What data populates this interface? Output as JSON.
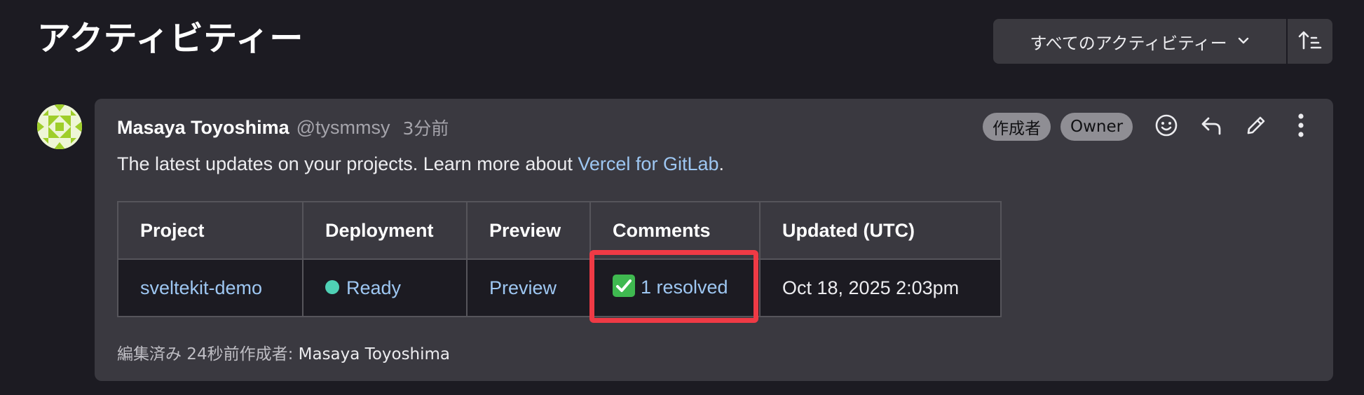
{
  "header": {
    "title": "アクティビティー",
    "filter_label": "すべてのアクティビティー",
    "sort_icon": "sort-ascending-icon"
  },
  "note": {
    "author_name": "Masaya Toyoshima",
    "author_handle": "@tysmmsy",
    "time_ago": "3分前",
    "badges": [
      "作成者",
      "Owner"
    ],
    "actions": [
      "smile-icon",
      "reply-icon",
      "pencil-icon",
      "more-vertical-icon"
    ],
    "body_prefix": "The latest updates on your projects. Learn more about ",
    "body_link": "Vercel for GitLab",
    "body_suffix": ".",
    "table": {
      "headers": [
        "Project",
        "Deployment",
        "Preview",
        "Comments",
        "Updated (UTC)"
      ],
      "row": {
        "project": "sveltekit-demo",
        "deployment": "Ready",
        "preview": "Preview",
        "comments": "1 resolved",
        "updated": "Oct 18, 2025 2:03pm"
      }
    },
    "footer_prefix": "編集済み 24秒前作成者: ",
    "footer_editor": "Masaya Toyoshima"
  },
  "colors": {
    "background": "#1c1b22",
    "card": "#3a3940",
    "link": "#9ec7f2",
    "ready_dot": "#4fd1b5",
    "highlight": "#ef3a45"
  }
}
